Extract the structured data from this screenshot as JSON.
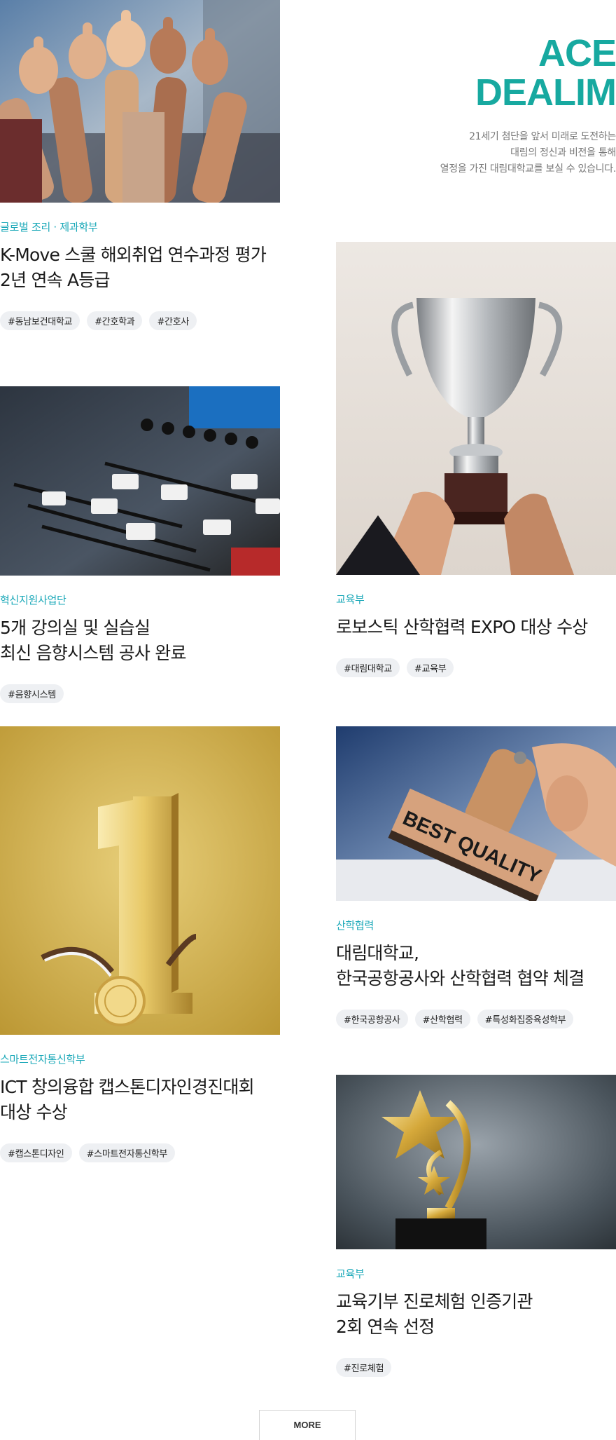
{
  "intro": {
    "heading_lines": [
      "ACE",
      "DEALIM"
    ],
    "description_lines": [
      "21세기 첨단을 앞서 미래로 도전하는",
      "대림의 정신과 비전을 통해",
      "열정을 가진 대림대학교를 보실 수 있습니다."
    ],
    "accent_color": "#17a9a0"
  },
  "cards": [
    {
      "category": "글로벌 조리 · 제과학부",
      "title_lines": [
        "K-Move 스쿨 해외취업 연수과정 평가",
        "2년 연속 A등급"
      ],
      "tags": [
        "#동남보건대학교",
        "#간호학과",
        "#간호사"
      ],
      "image": "thumbs-up-hands-photo"
    },
    {
      "category": "교육부",
      "title_lines": [
        "로보스틱 산학협력 EXPO 대상 수상"
      ],
      "tags": [
        "#대림대학교",
        "#교육부"
      ],
      "image": "trophy-photo"
    },
    {
      "category": "혁신지원사업단",
      "title_lines": [
        "5개 강의실 및 실습실",
        "최신 음향시스템 공사 완료"
      ],
      "tags": [
        "#음향시스템"
      ],
      "image": "audio-mixer-photo"
    },
    {
      "category": "산학협력",
      "title_lines": [
        "대림대학교,",
        "한국공항공사와 산학협력 협약 체결"
      ],
      "tags": [
        "#한국공항공사",
        "#산학협력",
        "#특성화집중육성학부"
      ],
      "image": "best-quality-stamp-photo",
      "stamp_text": "BEST QUALITY"
    },
    {
      "category": "스마트전자통신학부",
      "title_lines": [
        "ICT 창의융합 캡스톤디자인경진대회",
        "대상 수상"
      ],
      "tags": [
        "#캡스톤디자인",
        "#스마트전자통신학부"
      ],
      "image": "number-one-medal-photo"
    },
    {
      "category": "교육부",
      "title_lines": [
        "교육기부 진로체험 인증기관",
        "2회 연속 선정"
      ],
      "tags": [
        "#진로체험"
      ],
      "image": "star-trophy-photo"
    }
  ],
  "more_button": {
    "label": "MORE"
  }
}
